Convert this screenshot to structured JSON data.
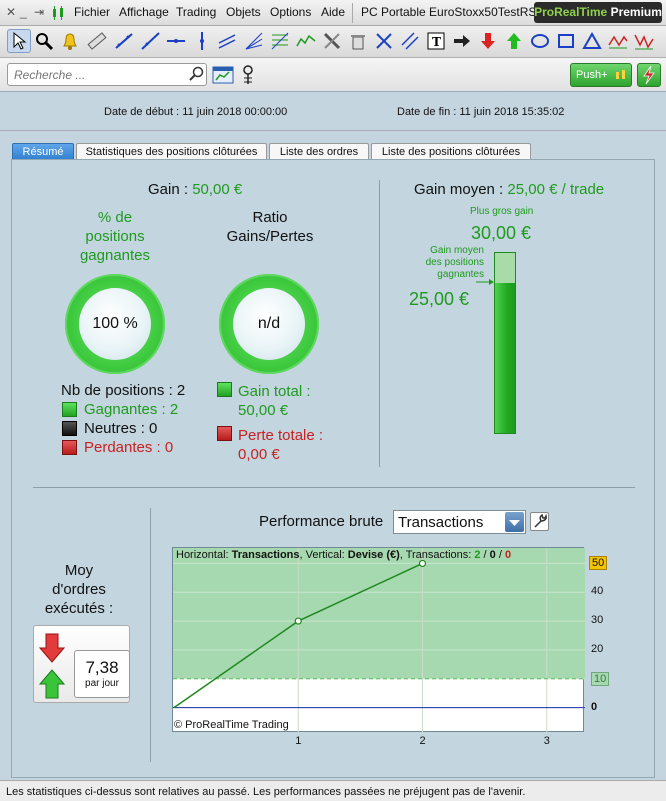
{
  "menubar": {
    "items": [
      "Fichier",
      "Affichage",
      "Trading",
      "Objets",
      "Options",
      "Aide"
    ],
    "window_title": "PC Portable EuroStoxx50TestRSI",
    "brand_pro": "ProRealTime",
    "brand_premium": "Premium"
  },
  "toolbar": {
    "tools": [
      "pointer-icon",
      "zoom-icon",
      "alarm-bell-icon",
      "ruler-icon",
      "trend-line-icon",
      "ray-line-icon",
      "horizontal-line-icon",
      "vertical-line-icon",
      "channel-icon",
      "fan-icon",
      "fibonacci-icon",
      "pattern-icon",
      "tools-icon",
      "trash-icon",
      "cross-arrows-icon",
      "parallel-lines-icon",
      "text-icon",
      "arrow-right-icon",
      "arrow-down-red-icon",
      "arrow-up-green-icon",
      "ellipse-icon",
      "rectangle-icon",
      "triangle-icon",
      "zigzag-icon",
      "wave-icon"
    ]
  },
  "search": {
    "placeholder": "Recherche ...",
    "push_label": "Push+"
  },
  "dates": {
    "start": "Date de début :  11 juin 2018 00:00:00",
    "end": "Date de fin :  11 juin 2018 15:35:02"
  },
  "tabs": [
    "Résumé",
    "Statistiques des positions clôturées",
    "Liste des ordres",
    "Liste des positions clôturées"
  ],
  "summary": {
    "gain_label": "Gain :",
    "gain_value": "50,00 €",
    "pct_label_1": "% de",
    "pct_label_2": "positions",
    "pct_label_3": "gagnantes",
    "pct_value": "100 %",
    "ratio_label_1": "Ratio",
    "ratio_label_2": "Gains/Pertes",
    "ratio_value": "n/d",
    "nb_positions": "Nb de positions : 2",
    "gagnantes": "Gagnantes : 2",
    "neutres": "Neutres : 0",
    "perdantes": "Perdantes : 0",
    "gain_total_1": "Gain total :",
    "gain_total_2": "50,00 €",
    "perte_totale_1": "Perte totale :",
    "perte_totale_2": "0,00 €",
    "avg_gain_label": "Gain moyen :",
    "avg_gain_value": "25,00 € / trade",
    "biggest_gain_label": "Plus gros gain",
    "biggest_gain_value": "30,00 €",
    "avg_win_label_1": "Gain moyen",
    "avg_win_label_2": "des positions",
    "avg_win_label_3": "gagnantes",
    "avg_win_value": "25,00 €",
    "gauge_fraction": 0.8333
  },
  "orders": {
    "label_1": "Moy",
    "label_2": "d'ordres",
    "label_3": "exécutés :",
    "value": "7,38",
    "unit": "par jour"
  },
  "performance": {
    "title": "Performance brute",
    "selected": "Transactions",
    "info_1": "Horizontal: ",
    "info_2": "Transactions",
    "info_3": ", Vertical: ",
    "info_4": "Devise (€)",
    "info_5": ", Transactions: ",
    "info_6": "2",
    "info_7": " / ",
    "info_8": "0",
    "info_9": " / ",
    "info_10": "0",
    "copyright": "© ProRealTime Trading"
  },
  "chart_data": {
    "type": "line",
    "x": [
      0,
      1,
      2
    ],
    "y": [
      0,
      30,
      50
    ],
    "xlim": [
      0,
      3.3
    ],
    "ylim": [
      -5,
      55
    ],
    "x_ticks": [
      "1",
      "2",
      "3"
    ],
    "y_ticks": [
      "0",
      "10",
      "20",
      "30",
      "40",
      "50"
    ],
    "highlight_max": "50",
    "highlight_ref": "10",
    "zero_line": "0",
    "grid": true,
    "line_color": "#1e8a1e",
    "fill_color": "#a7d9b0"
  },
  "footer": {
    "text": "Les statistiques ci-dessus sont relatives au passé. Les performances passées ne préjugent pas de l'avenir."
  }
}
